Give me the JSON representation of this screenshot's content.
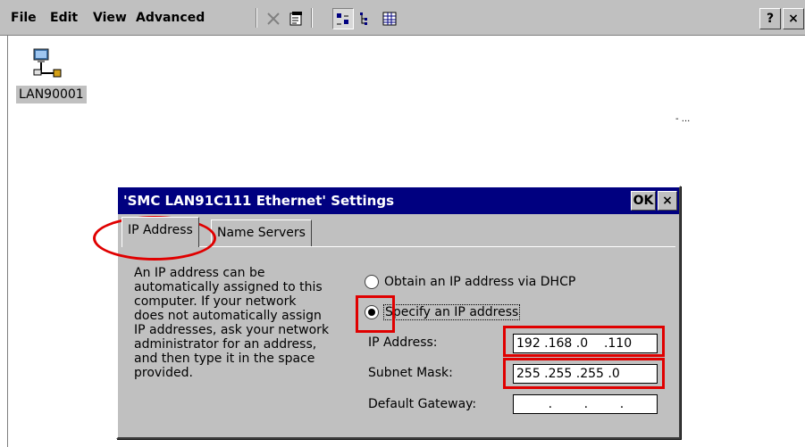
{
  "menubar": {
    "items": [
      "File",
      "Edit",
      "View",
      "Advanced"
    ],
    "help_label": "?",
    "close_label": "×"
  },
  "desktop": {
    "icon_label": "LAN90001",
    "stray_mark": "- ..."
  },
  "dialog": {
    "title": "'SMC LAN91C111 Ethernet' Settings",
    "ok_label": "OK",
    "close_label": "×",
    "tabs": [
      {
        "label": "IP Address",
        "active": true
      },
      {
        "label": "Name Servers",
        "active": false
      }
    ],
    "description": "An IP address can be\nautomatically assigned to this\ncomputer.  If your network\ndoes not automatically assign\nIP addresses, ask your network\nadministrator for an address,\nand then type it in the space\nprovided.",
    "radio_dhcp": {
      "label": "Obtain an IP address via DHCP",
      "selected": false
    },
    "radio_specify": {
      "label": "Specify an IP address",
      "selected": true
    },
    "fields": [
      {
        "label": "IP Address:",
        "value": "192 .168 .0    .110"
      },
      {
        "label": "Subnet Mask:",
        "value": "255 .255 .255 .0"
      },
      {
        "label": "Default Gateway:",
        "value": "        .        .        ."
      }
    ]
  },
  "colors": {
    "titlebar": "#000080",
    "window_face": "#c0c0c0",
    "annotation": "#e00000"
  }
}
